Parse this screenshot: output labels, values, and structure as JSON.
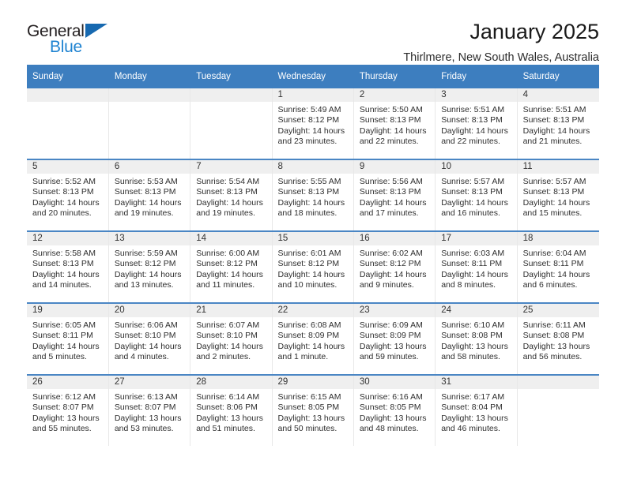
{
  "brand": {
    "name_top": "General",
    "name_bottom": "Blue",
    "accent_color": "#1f83d1",
    "triangle_color": "#1769b0"
  },
  "header": {
    "title": "January 2025",
    "location": "Thirlmere, New South Wales, Australia"
  },
  "theme": {
    "header_row_bg": "#3d7ebf",
    "header_row_text": "#ffffff",
    "daynum_strip_bg": "#efefef",
    "row_divider": "#4a86c4"
  },
  "weekdays": [
    "Sunday",
    "Monday",
    "Tuesday",
    "Wednesday",
    "Thursday",
    "Friday",
    "Saturday"
  ],
  "labels": {
    "sunrise": "Sunrise:",
    "sunset": "Sunset:",
    "daylight": "Daylight:"
  },
  "weeks": [
    [
      {
        "day": "",
        "empty": true
      },
      {
        "day": "",
        "empty": true
      },
      {
        "day": "",
        "empty": true
      },
      {
        "day": "1",
        "sunrise": "Sunrise: 5:49 AM",
        "sunset": "Sunset: 8:12 PM",
        "daylight1": "Daylight: 14 hours",
        "daylight2": "and 23 minutes."
      },
      {
        "day": "2",
        "sunrise": "Sunrise: 5:50 AM",
        "sunset": "Sunset: 8:13 PM",
        "daylight1": "Daylight: 14 hours",
        "daylight2": "and 22 minutes."
      },
      {
        "day": "3",
        "sunrise": "Sunrise: 5:51 AM",
        "sunset": "Sunset: 8:13 PM",
        "daylight1": "Daylight: 14 hours",
        "daylight2": "and 22 minutes."
      },
      {
        "day": "4",
        "sunrise": "Sunrise: 5:51 AM",
        "sunset": "Sunset: 8:13 PM",
        "daylight1": "Daylight: 14 hours",
        "daylight2": "and 21 minutes."
      }
    ],
    [
      {
        "day": "5",
        "sunrise": "Sunrise: 5:52 AM",
        "sunset": "Sunset: 8:13 PM",
        "daylight1": "Daylight: 14 hours",
        "daylight2": "and 20 minutes."
      },
      {
        "day": "6",
        "sunrise": "Sunrise: 5:53 AM",
        "sunset": "Sunset: 8:13 PM",
        "daylight1": "Daylight: 14 hours",
        "daylight2": "and 19 minutes."
      },
      {
        "day": "7",
        "sunrise": "Sunrise: 5:54 AM",
        "sunset": "Sunset: 8:13 PM",
        "daylight1": "Daylight: 14 hours",
        "daylight2": "and 19 minutes."
      },
      {
        "day": "8",
        "sunrise": "Sunrise: 5:55 AM",
        "sunset": "Sunset: 8:13 PM",
        "daylight1": "Daylight: 14 hours",
        "daylight2": "and 18 minutes."
      },
      {
        "day": "9",
        "sunrise": "Sunrise: 5:56 AM",
        "sunset": "Sunset: 8:13 PM",
        "daylight1": "Daylight: 14 hours",
        "daylight2": "and 17 minutes."
      },
      {
        "day": "10",
        "sunrise": "Sunrise: 5:57 AM",
        "sunset": "Sunset: 8:13 PM",
        "daylight1": "Daylight: 14 hours",
        "daylight2": "and 16 minutes."
      },
      {
        "day": "11",
        "sunrise": "Sunrise: 5:57 AM",
        "sunset": "Sunset: 8:13 PM",
        "daylight1": "Daylight: 14 hours",
        "daylight2": "and 15 minutes."
      }
    ],
    [
      {
        "day": "12",
        "sunrise": "Sunrise: 5:58 AM",
        "sunset": "Sunset: 8:13 PM",
        "daylight1": "Daylight: 14 hours",
        "daylight2": "and 14 minutes."
      },
      {
        "day": "13",
        "sunrise": "Sunrise: 5:59 AM",
        "sunset": "Sunset: 8:12 PM",
        "daylight1": "Daylight: 14 hours",
        "daylight2": "and 13 minutes."
      },
      {
        "day": "14",
        "sunrise": "Sunrise: 6:00 AM",
        "sunset": "Sunset: 8:12 PM",
        "daylight1": "Daylight: 14 hours",
        "daylight2": "and 11 minutes."
      },
      {
        "day": "15",
        "sunrise": "Sunrise: 6:01 AM",
        "sunset": "Sunset: 8:12 PM",
        "daylight1": "Daylight: 14 hours",
        "daylight2": "and 10 minutes."
      },
      {
        "day": "16",
        "sunrise": "Sunrise: 6:02 AM",
        "sunset": "Sunset: 8:12 PM",
        "daylight1": "Daylight: 14 hours",
        "daylight2": "and 9 minutes."
      },
      {
        "day": "17",
        "sunrise": "Sunrise: 6:03 AM",
        "sunset": "Sunset: 8:11 PM",
        "daylight1": "Daylight: 14 hours",
        "daylight2": "and 8 minutes."
      },
      {
        "day": "18",
        "sunrise": "Sunrise: 6:04 AM",
        "sunset": "Sunset: 8:11 PM",
        "daylight1": "Daylight: 14 hours",
        "daylight2": "and 6 minutes."
      }
    ],
    [
      {
        "day": "19",
        "sunrise": "Sunrise: 6:05 AM",
        "sunset": "Sunset: 8:11 PM",
        "daylight1": "Daylight: 14 hours",
        "daylight2": "and 5 minutes."
      },
      {
        "day": "20",
        "sunrise": "Sunrise: 6:06 AM",
        "sunset": "Sunset: 8:10 PM",
        "daylight1": "Daylight: 14 hours",
        "daylight2": "and 4 minutes."
      },
      {
        "day": "21",
        "sunrise": "Sunrise: 6:07 AM",
        "sunset": "Sunset: 8:10 PM",
        "daylight1": "Daylight: 14 hours",
        "daylight2": "and 2 minutes."
      },
      {
        "day": "22",
        "sunrise": "Sunrise: 6:08 AM",
        "sunset": "Sunset: 8:09 PM",
        "daylight1": "Daylight: 14 hours",
        "daylight2": "and 1 minute."
      },
      {
        "day": "23",
        "sunrise": "Sunrise: 6:09 AM",
        "sunset": "Sunset: 8:09 PM",
        "daylight1": "Daylight: 13 hours",
        "daylight2": "and 59 minutes."
      },
      {
        "day": "24",
        "sunrise": "Sunrise: 6:10 AM",
        "sunset": "Sunset: 8:08 PM",
        "daylight1": "Daylight: 13 hours",
        "daylight2": "and 58 minutes."
      },
      {
        "day": "25",
        "sunrise": "Sunrise: 6:11 AM",
        "sunset": "Sunset: 8:08 PM",
        "daylight1": "Daylight: 13 hours",
        "daylight2": "and 56 minutes."
      }
    ],
    [
      {
        "day": "26",
        "sunrise": "Sunrise: 6:12 AM",
        "sunset": "Sunset: 8:07 PM",
        "daylight1": "Daylight: 13 hours",
        "daylight2": "and 55 minutes."
      },
      {
        "day": "27",
        "sunrise": "Sunrise: 6:13 AM",
        "sunset": "Sunset: 8:07 PM",
        "daylight1": "Daylight: 13 hours",
        "daylight2": "and 53 minutes."
      },
      {
        "day": "28",
        "sunrise": "Sunrise: 6:14 AM",
        "sunset": "Sunset: 8:06 PM",
        "daylight1": "Daylight: 13 hours",
        "daylight2": "and 51 minutes."
      },
      {
        "day": "29",
        "sunrise": "Sunrise: 6:15 AM",
        "sunset": "Sunset: 8:05 PM",
        "daylight1": "Daylight: 13 hours",
        "daylight2": "and 50 minutes."
      },
      {
        "day": "30",
        "sunrise": "Sunrise: 6:16 AM",
        "sunset": "Sunset: 8:05 PM",
        "daylight1": "Daylight: 13 hours",
        "daylight2": "and 48 minutes."
      },
      {
        "day": "31",
        "sunrise": "Sunrise: 6:17 AM",
        "sunset": "Sunset: 8:04 PM",
        "daylight1": "Daylight: 13 hours",
        "daylight2": "and 46 minutes."
      },
      {
        "day": "",
        "empty": true
      }
    ]
  ]
}
